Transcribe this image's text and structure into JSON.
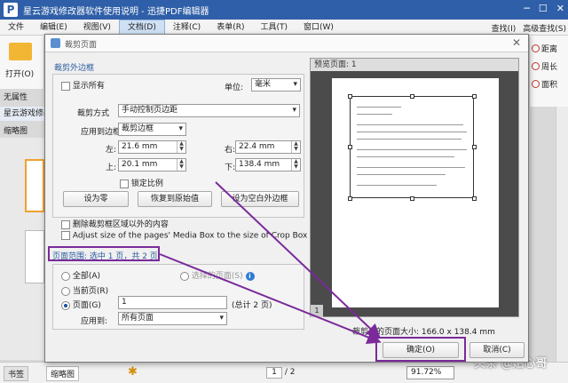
{
  "app": {
    "title": "星云游戏修改器软件使用说明 - 迅捷PDF编辑器",
    "logo": "P",
    "window_buttons": [
      "─",
      "☐",
      "✕"
    ]
  },
  "menu": {
    "items": [
      "文件",
      "编辑(E)",
      "视图(V)",
      "文档(D)",
      "注释(C)",
      "表单(R)",
      "工具(T)",
      "窗口(W)"
    ],
    "active_index": 3,
    "right": [
      "查找(I)",
      "高级查找(S)"
    ]
  },
  "left": {
    "open_label": "打开(O)",
    "no_attr": "无属性",
    "doc_tab": "星云游戏修改",
    "thumb_label": "缩略图"
  },
  "right_ribbon": [
    "距离",
    "周长",
    "面积"
  ],
  "status": {
    "bookmark_tab": "书签",
    "thumb_tab": "缩略图",
    "page_current": "1",
    "page_total": "/ 2",
    "zoom": "91.72%",
    "watermark": "头条 @贴心哥"
  },
  "dialog": {
    "title": "裁剪页面",
    "crop_margin_head": "裁剪外边框",
    "show_all": "显示所有",
    "unit_label": "单位:",
    "unit_value": "毫米",
    "crop_method_label": "裁剪方式",
    "crop_method_value": "手动控制页边距",
    "apply_box_label": "应用到边框",
    "apply_box_value": "裁剪边框",
    "left_label": "左:",
    "left_value": "21.6 mm",
    "right_label": "右:",
    "right_value": "22.4 mm",
    "top_label": "上:",
    "top_value": "20.1 mm",
    "bottom_label": "下:",
    "bottom_value": "138.4 mm",
    "lock_ratio": "锁定比例",
    "btn_zero": "设为零",
    "btn_restore": "恢复到原始值",
    "btn_blank": "设为空白外边框",
    "delete_outside": "删除裁剪框区域以外的内容",
    "adjust_media": "Adjust size of the pages' Media Box to the size of Crop Box",
    "page_range_head": "页面范围: 选中 1 页，共 2 页",
    "range_all": "全部(A)",
    "range_selected": "选择的页面(S)",
    "range_current": "当前页(R)",
    "range_pages": "页面(G)",
    "range_pages_value": "1",
    "range_total": "(总计 2 页)",
    "apply_to_label": "应用到:",
    "apply_to_value": "所有页面",
    "preview_head": "预览页面: 1",
    "preview_pager": "1",
    "crop_size": "裁剪后的页面大小: 166.0 x 138.4 mm",
    "ok": "确定(O)",
    "cancel": "取消(C)",
    "info_glyph": "i"
  },
  "colors": {
    "titlebar": "#2f5fa8",
    "highlight": "#7a2a9a",
    "section_head": "#2b5c9e"
  }
}
